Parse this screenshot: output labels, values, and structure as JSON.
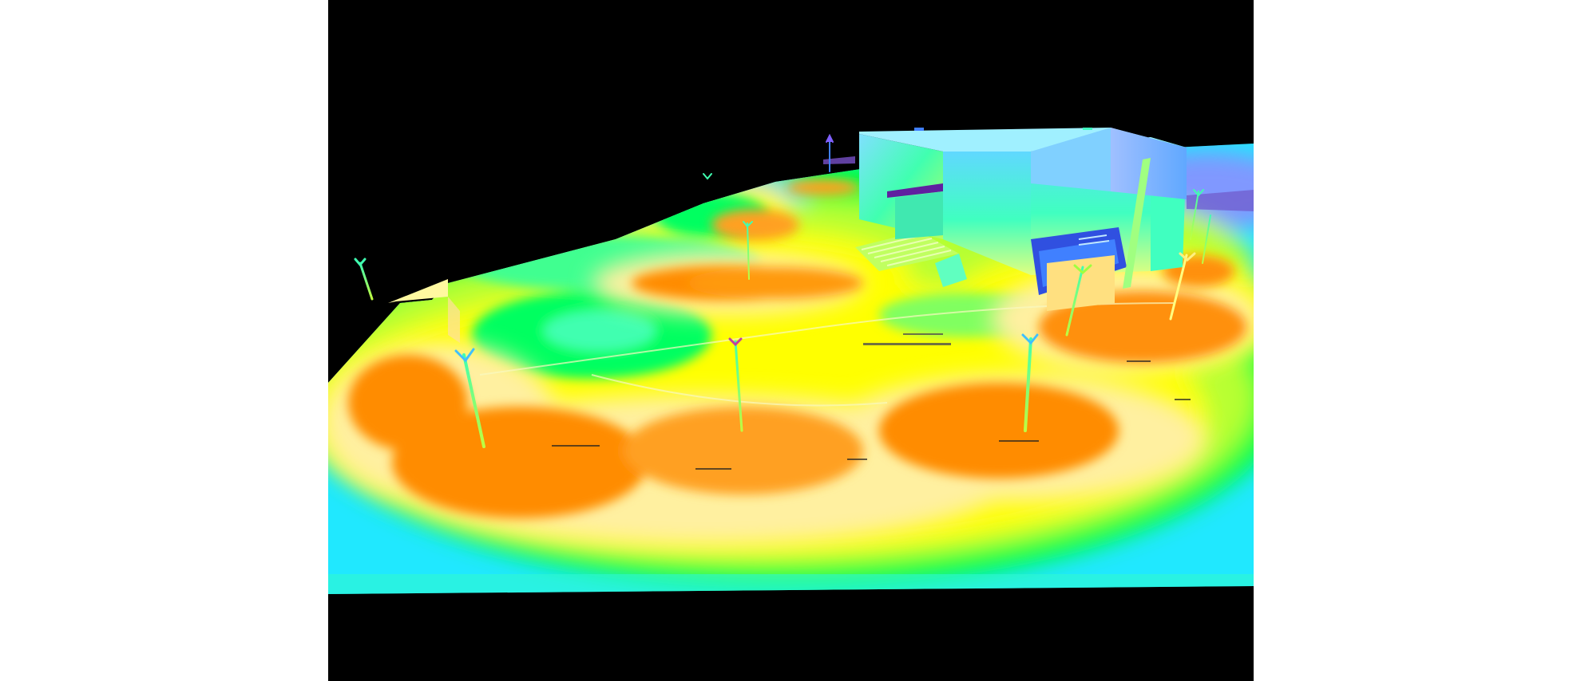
{
  "scene": {
    "type": "3d-illuminance-false-color-render",
    "background_color": "#000000",
    "page_background_color": "#ffffff",
    "colors": {
      "orange_high": "#ff8c00",
      "light_orange": "#ffc060",
      "pale_yellow": "#fff0a0",
      "yellow": "#ffff00",
      "yellow_green": "#b8ff30",
      "green": "#00ff40",
      "mint": "#40ffb0",
      "cyan": "#00f0ff",
      "light_blue": "#80b8ff",
      "purple_low": "#6040a0"
    },
    "description_tags": [
      "ground-plane",
      "building-block",
      "stairs",
      "light-poles"
    ]
  }
}
